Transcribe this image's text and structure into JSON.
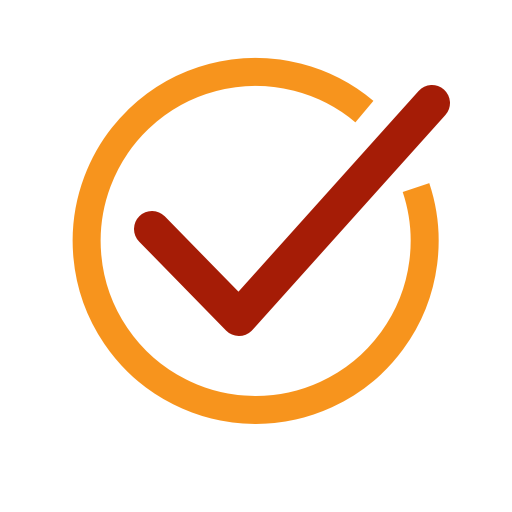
{
  "icon": {
    "name": "check-circle-icon",
    "ring_color": "#F7941D",
    "check_color": "#A51C06",
    "background_color": "#FFFFFF"
  }
}
